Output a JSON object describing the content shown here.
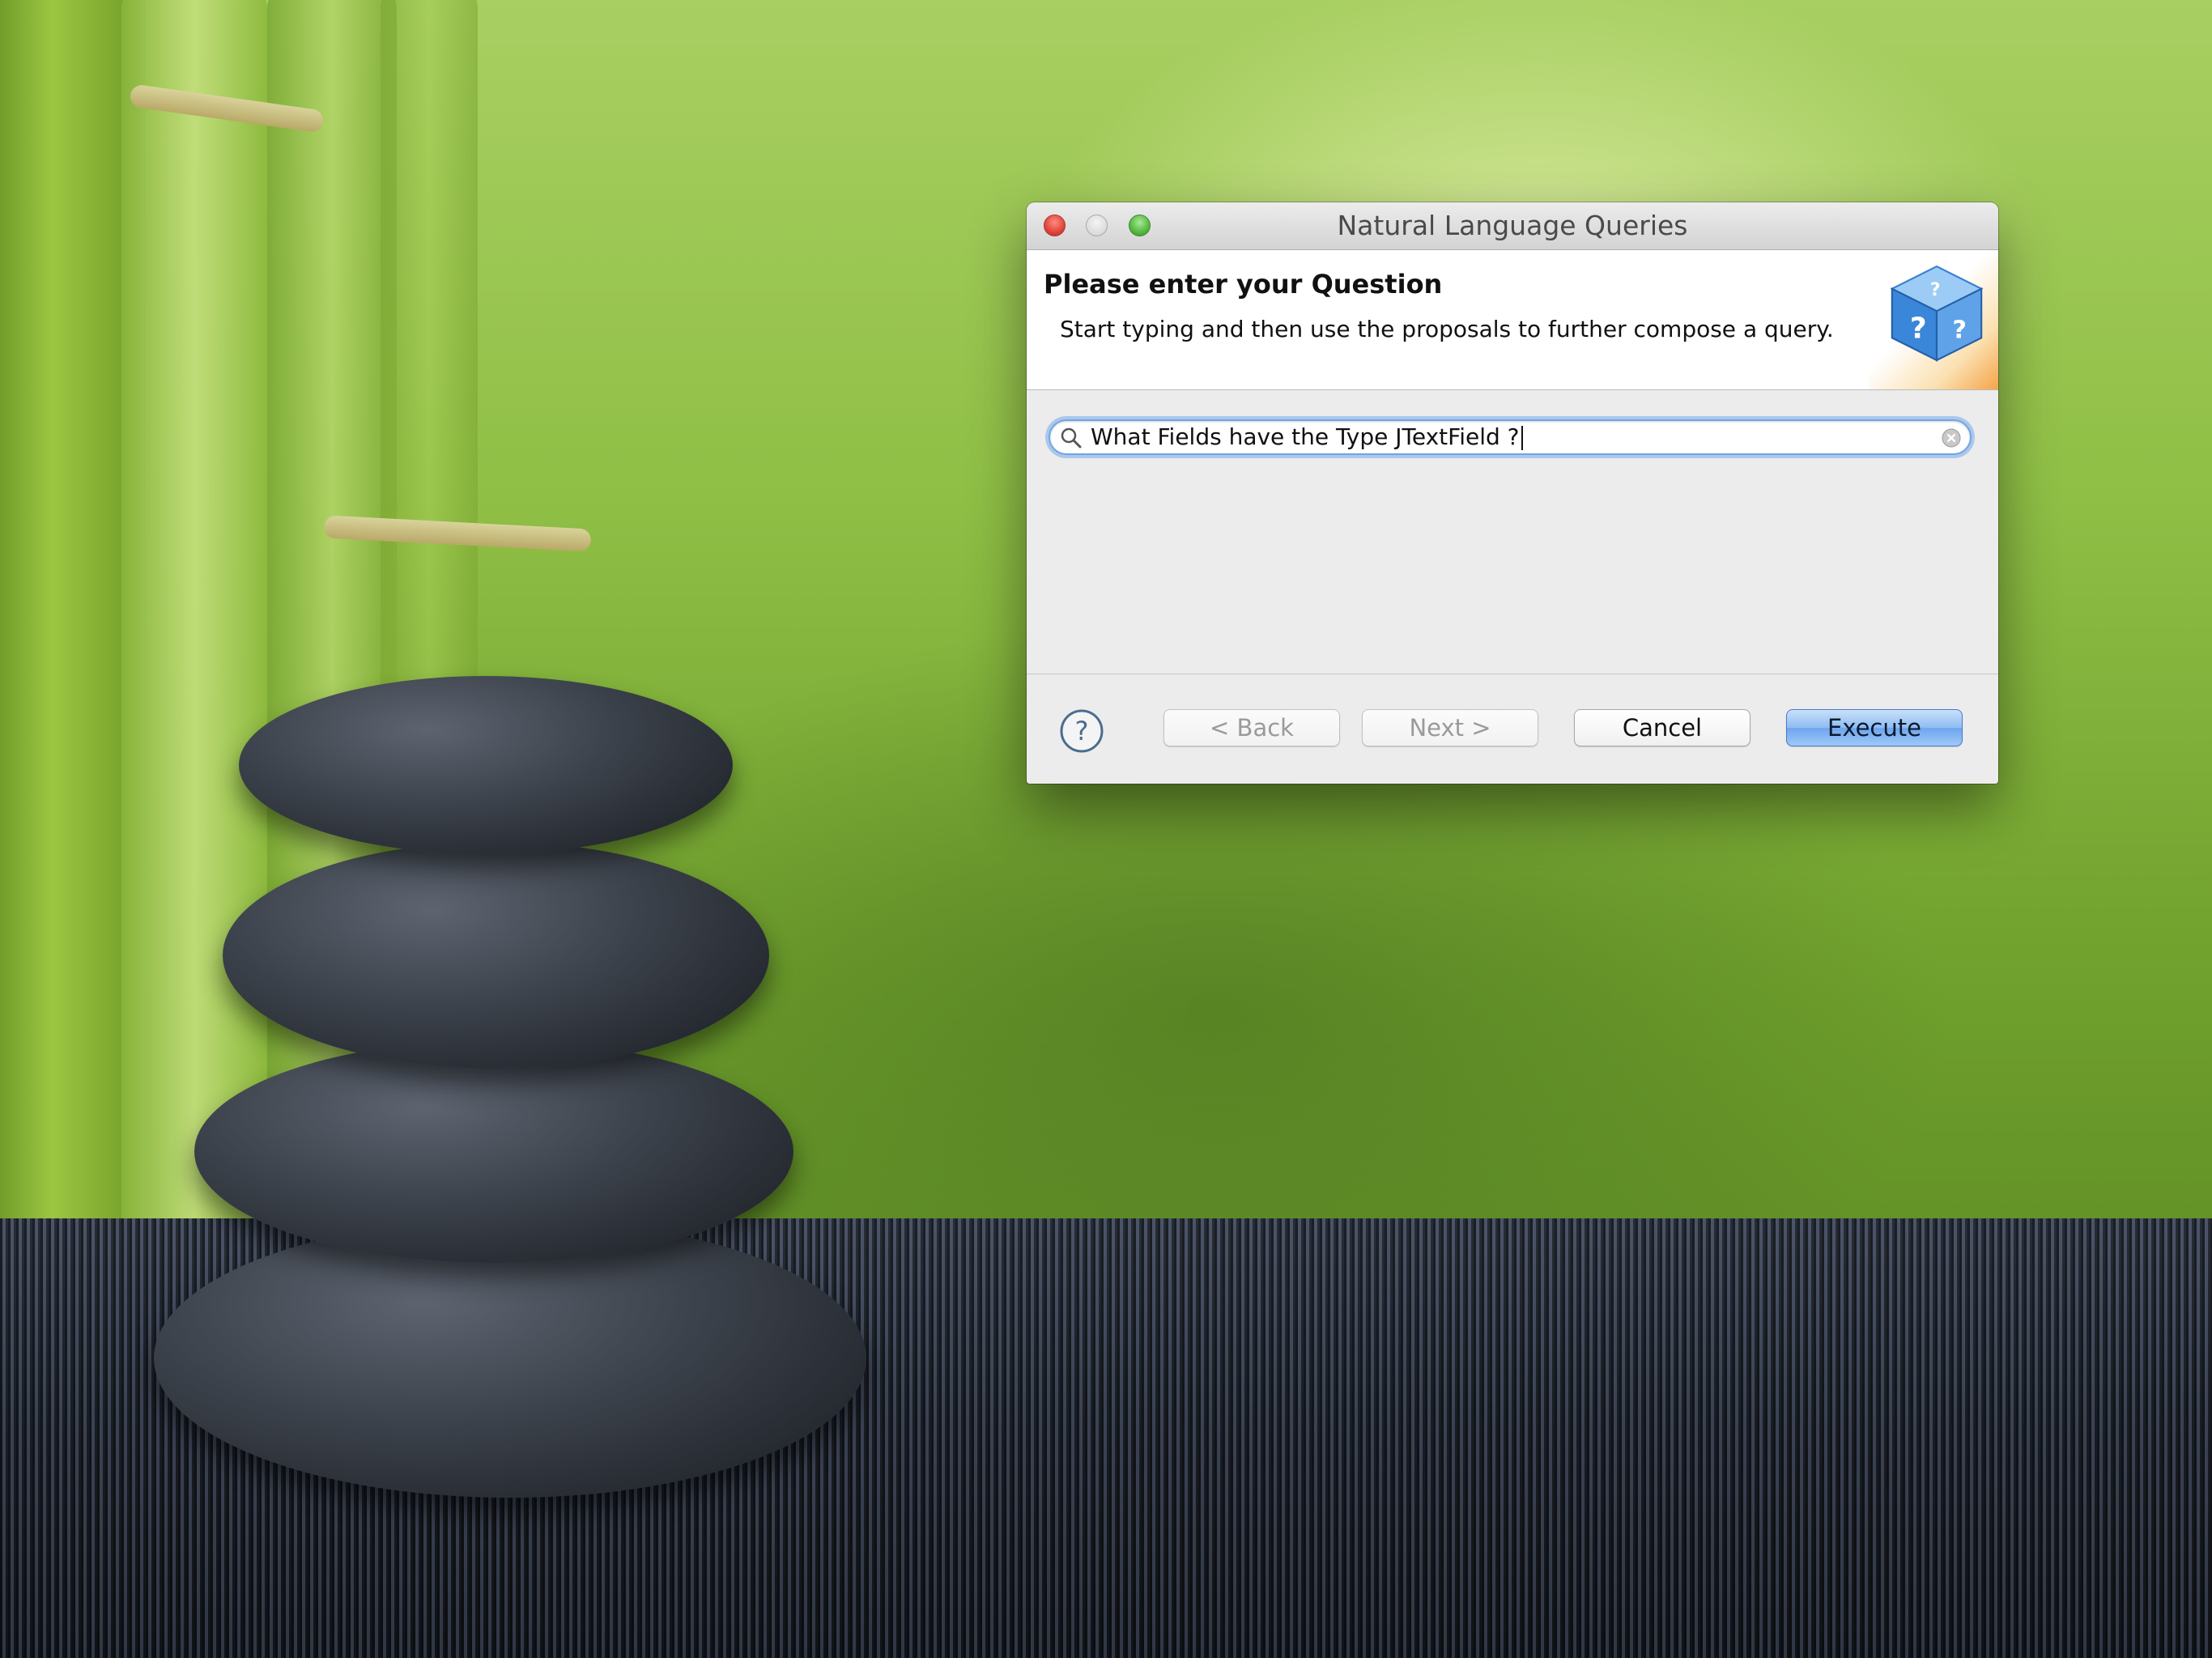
{
  "dialog": {
    "title": "Natural Language Queries",
    "header_title": "Please enter your Question",
    "header_description": "Start typing and then use the proposals to further compose a query.",
    "banner_icon": "question-cube-icon"
  },
  "search": {
    "value": "What Fields have the Type JTextField ?",
    "icon": "search-icon",
    "clear_icon": "clear-icon"
  },
  "buttons": {
    "help_icon": "help-icon",
    "back_label": "< Back",
    "next_label": "Next >",
    "cancel_label": "Cancel",
    "execute_label": "Execute"
  },
  "colors": {
    "accent": "#6ea5ee",
    "close": "#e0443a",
    "zoom": "#55b83d"
  }
}
